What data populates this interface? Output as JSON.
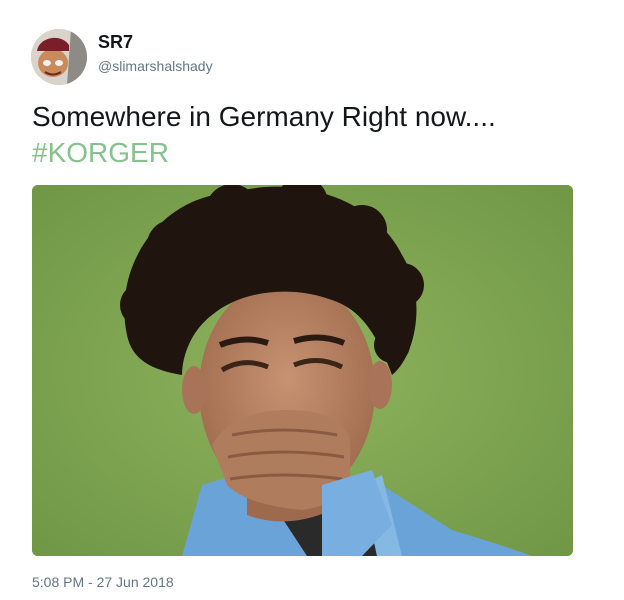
{
  "user": {
    "display_name": "SR7",
    "handle": "@slimarshalshady"
  },
  "tweet": {
    "text": "Somewhere in Germany Right now....",
    "hashtag": "#KORGER",
    "timestamp": "5:08 PM - 27 Jun 2018"
  },
  "colors": {
    "hashtag": "#87c18e",
    "secondary_text": "#657786",
    "primary_text": "#14171a",
    "photo_background": "#7ea653"
  },
  "icons": {
    "avatar": "profile-photo",
    "media": "photo-laughing-player"
  }
}
